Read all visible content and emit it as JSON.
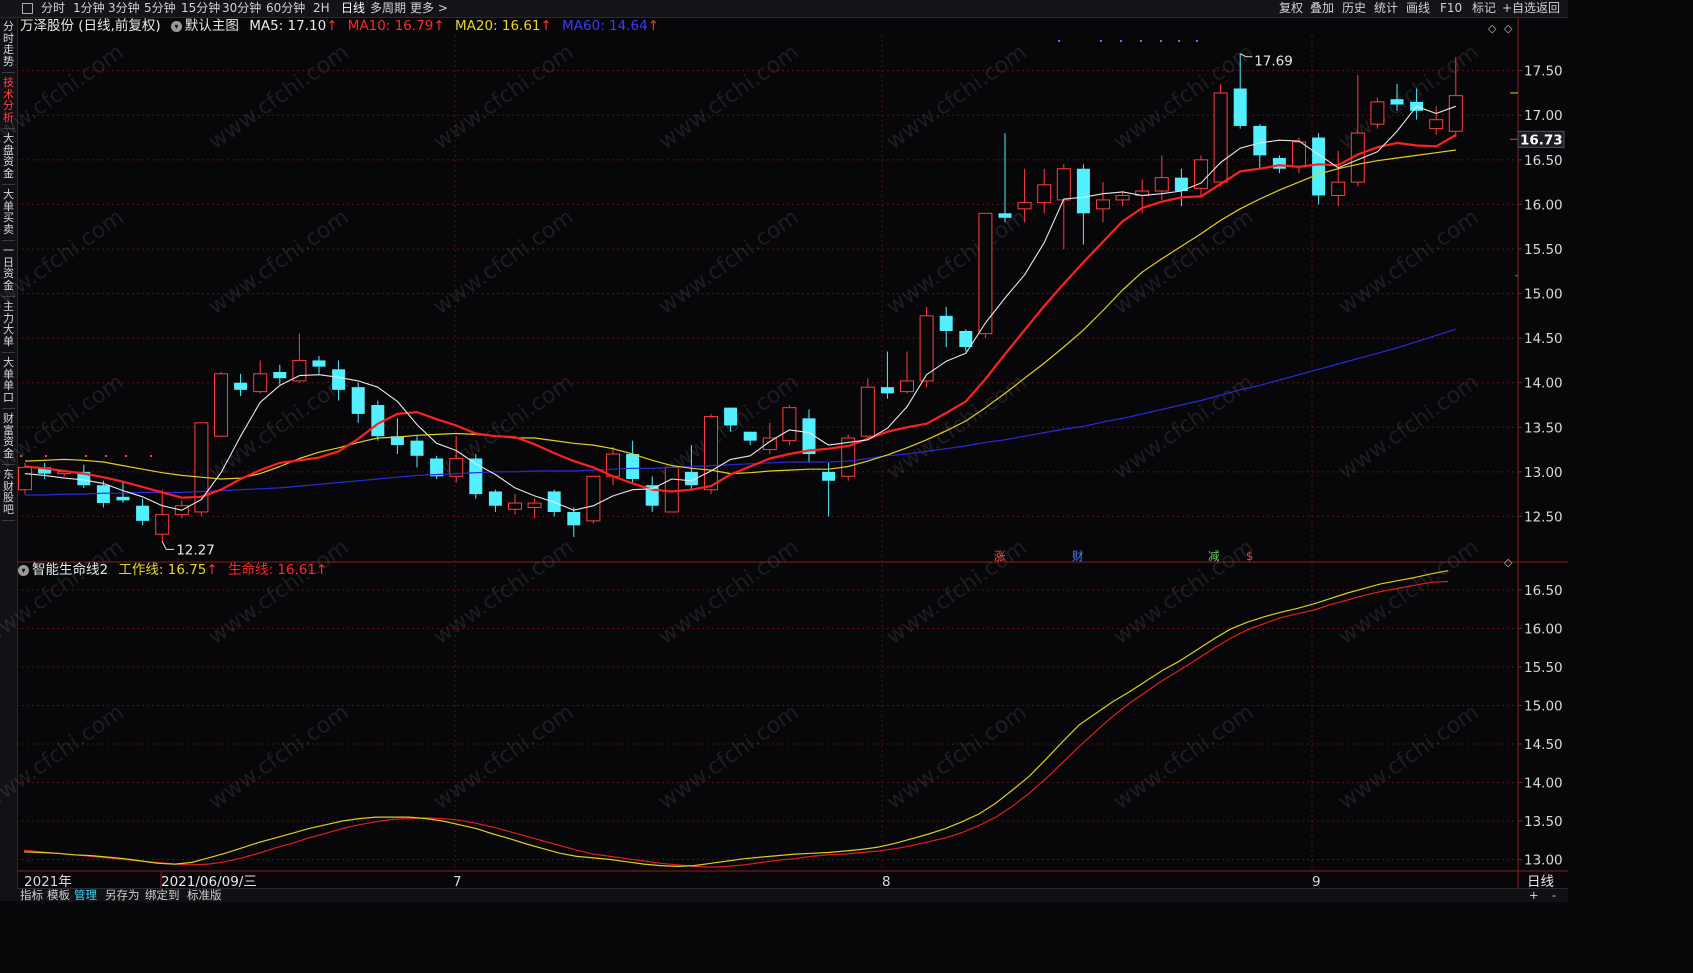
{
  "topbar": {
    "left_items": [
      "分时",
      "1分钟",
      "3分钟",
      "5分钟",
      "15分钟",
      "30分钟",
      "60分钟",
      "2H",
      "日线",
      "多周期",
      "更多 >"
    ],
    "active_left": "日线",
    "right_items": [
      "复权",
      "叠加",
      "历史",
      "统计",
      "画线",
      "F10",
      "标记",
      "+自选",
      "返回"
    ]
  },
  "sidebar": {
    "items": [
      "分时走势",
      "技术分析",
      "大盘资金",
      "大单买卖",
      "一日资金",
      "主力大单",
      "大单单口",
      "财富资金",
      "东财股吧"
    ],
    "active": "技术分析"
  },
  "main_header": {
    "stock": "万泽股份 (日线,前复权)",
    "template": "默认主图",
    "ma5": "MA5: 17.10",
    "ma10": "MA10: 16.79",
    "ma20": "MA20: 16.61",
    "ma60": "MA60: 14.64",
    "arrow": "↑"
  },
  "sub_header": {
    "indicator": "智能生命线2",
    "work": "工作线: 16.75",
    "life": "生命线: 16.61",
    "arrow": "↑"
  },
  "annotations": {
    "high": "17.69",
    "low": "12.27",
    "current": "16.73",
    "events": [
      "涨",
      "财",
      "减",
      "$"
    ]
  },
  "x_axis": {
    "labels": [
      "2021年",
      "2021/06/09/三",
      "7",
      "8",
      "9"
    ],
    "period": "日线"
  },
  "bottom_bar": {
    "items": [
      "指标",
      "模板",
      "管理",
      "另存为",
      "绑定到",
      "标准版"
    ],
    "active": "管理",
    "zoom_in": "+",
    "zoom_out": "-"
  },
  "watermark": "www.cfchi.com",
  "colors": {
    "up": "#ff3c3c",
    "down": "#52f0ff",
    "ma5": "#e8e8e8",
    "ma10": "#ff2020",
    "ma20": "#e0d020",
    "ma60": "#2a2ad8",
    "work": "#d8d020",
    "life": "#e01e1e"
  },
  "chart_data": [
    {
      "type": "candlestick",
      "price_ticks": [
        12.5,
        13.0,
        13.5,
        14.0,
        14.5,
        15.0,
        15.5,
        16.0,
        16.5,
        17.0,
        17.5
      ],
      "ylim": [
        12.0,
        17.9
      ],
      "candles": [
        [
          12.8,
          13.05,
          13.1,
          12.75
        ],
        [
          13.05,
          12.98,
          13.1,
          12.92
        ],
        [
          12.98,
          13.0,
          13.02,
          12.95
        ],
        [
          13.0,
          12.85,
          13.08,
          12.82
        ],
        [
          12.85,
          12.65,
          12.9,
          12.6
        ],
        [
          12.72,
          12.68,
          12.9,
          12.65
        ],
        [
          12.62,
          12.45,
          12.7,
          12.4
        ],
        [
          12.3,
          12.52,
          12.8,
          12.22
        ],
        [
          12.52,
          12.62,
          12.68,
          12.48
        ],
        [
          12.55,
          13.55,
          13.55,
          12.5
        ],
        [
          13.4,
          14.1,
          14.12,
          13.4
        ],
        [
          14.0,
          13.92,
          14.1,
          13.85
        ],
        [
          13.9,
          14.1,
          14.25,
          13.88
        ],
        [
          14.12,
          14.05,
          14.2,
          13.98
        ],
        [
          14.02,
          14.25,
          14.55,
          14.0
        ],
        [
          14.25,
          14.18,
          14.3,
          14.1
        ],
        [
          14.15,
          13.92,
          14.25,
          13.8
        ],
        [
          13.95,
          13.65,
          14.0,
          13.55
        ],
        [
          13.75,
          13.4,
          13.8,
          13.35
        ],
        [
          13.4,
          13.3,
          13.6,
          13.2
        ],
        [
          13.35,
          13.18,
          13.4,
          13.05
        ],
        [
          13.15,
          12.95,
          13.18,
          12.92
        ],
        [
          12.95,
          13.15,
          13.4,
          12.88
        ],
        [
          13.15,
          12.75,
          13.2,
          12.7
        ],
        [
          12.78,
          12.62,
          12.8,
          12.55
        ],
        [
          12.58,
          12.65,
          12.75,
          12.52
        ],
        [
          12.6,
          12.65,
          12.7,
          12.48
        ],
        [
          12.78,
          12.55,
          12.8,
          12.5
        ],
        [
          12.55,
          12.4,
          12.6,
          12.27
        ],
        [
          12.45,
          12.95,
          12.95,
          12.42
        ],
        [
          12.95,
          13.2,
          13.28,
          12.85
        ],
        [
          13.2,
          12.92,
          13.35,
          12.88
        ],
        [
          12.85,
          12.62,
          12.95,
          12.55
        ],
        [
          12.55,
          13.05,
          13.05,
          12.55
        ],
        [
          13.0,
          12.85,
          13.3,
          12.8
        ],
        [
          12.8,
          13.62,
          13.65,
          12.75
        ],
        [
          13.72,
          13.52,
          13.72,
          13.45
        ],
        [
          13.45,
          13.35,
          13.45,
          13.3
        ],
        [
          13.25,
          13.38,
          13.55,
          13.2
        ],
        [
          13.35,
          13.72,
          13.75,
          13.3
        ],
        [
          13.6,
          13.2,
          13.7,
          13.1
        ],
        [
          13.0,
          12.9,
          13.1,
          12.5
        ],
        [
          12.95,
          13.38,
          13.42,
          12.9
        ],
        [
          13.4,
          13.95,
          14.05,
          13.35
        ],
        [
          13.95,
          13.88,
          14.35,
          13.82
        ],
        [
          13.9,
          14.02,
          14.35,
          13.88
        ],
        [
          14.02,
          14.75,
          14.85,
          13.95
        ],
        [
          14.75,
          14.58,
          14.85,
          14.4
        ],
        [
          14.58,
          14.4,
          14.6,
          14.35
        ],
        [
          14.55,
          15.9,
          15.9,
          14.5
        ],
        [
          15.9,
          15.85,
          16.8,
          15.8
        ],
        [
          15.95,
          16.02,
          16.4,
          15.8
        ],
        [
          16.02,
          16.22,
          16.4,
          15.9
        ],
        [
          16.05,
          16.4,
          16.45,
          15.5
        ],
        [
          16.4,
          15.9,
          16.45,
          15.55
        ],
        [
          15.95,
          16.05,
          16.25,
          15.8
        ],
        [
          16.05,
          16.1,
          16.15,
          15.98
        ],
        [
          16.1,
          16.15,
          16.28,
          15.9
        ],
        [
          16.15,
          16.3,
          16.55,
          16.05
        ],
        [
          16.3,
          16.15,
          16.4,
          15.98
        ],
        [
          16.18,
          16.5,
          16.55,
          16.1
        ],
        [
          16.25,
          17.25,
          17.35,
          16.2
        ],
        [
          17.3,
          16.88,
          17.69,
          16.85
        ],
        [
          16.88,
          16.55,
          16.9,
          16.4
        ],
        [
          16.52,
          16.4,
          16.55,
          16.35
        ],
        [
          16.42,
          16.7,
          16.75,
          16.35
        ],
        [
          16.75,
          16.1,
          16.8,
          16.0
        ],
        [
          16.1,
          16.25,
          16.6,
          15.98
        ],
        [
          16.25,
          16.8,
          17.45,
          16.2
        ],
        [
          16.9,
          17.15,
          17.2,
          16.85
        ],
        [
          17.18,
          17.12,
          17.35,
          17.05
        ],
        [
          17.15,
          17.05,
          17.3,
          16.95
        ],
        [
          16.85,
          16.95,
          17.1,
          16.78
        ],
        [
          16.82,
          17.22,
          17.65,
          16.75
        ]
      ],
      "ma5": [
        12.98,
        12.96,
        12.93,
        12.91,
        12.87,
        12.79,
        12.72,
        12.62,
        12.57,
        12.69,
        12.99,
        13.4,
        13.78,
        13.97,
        14.08,
        14.09,
        14.06,
        14.02,
        13.95,
        13.79,
        13.53,
        13.32,
        13.24,
        13.09,
        12.97,
        12.82,
        12.73,
        12.66,
        12.57,
        12.62,
        12.73,
        12.8,
        12.81,
        12.92,
        12.9,
        13.01,
        13.14,
        13.18,
        13.34,
        13.47,
        13.44,
        13.3,
        13.33,
        13.36,
        13.49,
        13.73,
        14.09,
        14.24,
        14.33,
        14.67,
        14.95,
        15.21,
        15.57,
        16.06,
        16.08,
        16.12,
        16.14,
        16.1,
        16.12,
        16.15,
        16.24,
        16.47,
        16.63,
        16.69,
        16.72,
        16.71,
        16.56,
        16.41,
        16.5,
        16.59,
        16.82,
        17.1,
        17.02,
        17.1
      ],
      "ma10": [
        13.06,
        13.04,
        13.01,
        12.98,
        12.94,
        12.89,
        12.83,
        12.77,
        12.71,
        12.72,
        12.8,
        12.92,
        13.02,
        13.1,
        13.13,
        13.16,
        13.23,
        13.37,
        13.54,
        13.65,
        13.67,
        13.59,
        13.52,
        13.43,
        13.4,
        13.39,
        13.31,
        13.21,
        13.12,
        13.05,
        12.95,
        12.87,
        12.8,
        12.78,
        12.8,
        12.84,
        12.97,
        13.06,
        13.15,
        13.2,
        13.24,
        13.26,
        13.29,
        13.37,
        13.45,
        13.5,
        13.54,
        13.66,
        13.79,
        14.04,
        14.32,
        14.59,
        14.86,
        15.11,
        15.35,
        15.58,
        15.81,
        15.96,
        16.03,
        16.08,
        16.09,
        16.23,
        16.37,
        16.4,
        16.44,
        16.42,
        16.45,
        16.44,
        16.56,
        16.64,
        16.69,
        16.66,
        16.65,
        16.78
      ],
      "ma20": [
        13.12,
        13.13,
        13.14,
        13.13,
        13.11,
        13.07,
        13.03,
        12.99,
        12.96,
        12.94,
        12.92,
        12.93,
        12.98,
        13.06,
        13.15,
        13.22,
        13.27,
        13.33,
        13.38,
        13.39,
        13.41,
        13.42,
        13.43,
        13.42,
        13.4,
        13.38,
        13.38,
        13.35,
        13.32,
        13.3,
        13.26,
        13.2,
        13.13,
        13.07,
        13.04,
        13.02,
        12.98,
        12.99,
        13.01,
        13.02,
        13.03,
        13.03,
        13.06,
        13.12,
        13.19,
        13.27,
        13.36,
        13.46,
        13.57,
        13.72,
        13.88,
        14.05,
        14.22,
        14.4,
        14.59,
        14.81,
        15.04,
        15.24,
        15.39,
        15.53,
        15.67,
        15.82,
        15.95,
        16.06,
        16.16,
        16.25,
        16.34,
        16.4,
        16.45,
        16.49,
        16.52,
        16.55,
        16.58,
        16.61
      ],
      "ma60": [
        12.74,
        12.74,
        12.75,
        12.75,
        12.76,
        12.76,
        12.77,
        12.77,
        12.77,
        12.78,
        12.79,
        12.8,
        12.81,
        12.82,
        12.84,
        12.86,
        12.88,
        12.9,
        12.92,
        12.94,
        12.96,
        12.97,
        12.98,
        12.99,
        13.0,
        13.0,
        13.01,
        13.01,
        13.01,
        13.02,
        13.03,
        13.04,
        13.04,
        13.05,
        13.06,
        13.07,
        13.08,
        13.09,
        13.1,
        13.11,
        13.11,
        13.11,
        13.12,
        13.15,
        13.18,
        13.2,
        13.23,
        13.26,
        13.29,
        13.33,
        13.36,
        13.4,
        13.44,
        13.48,
        13.51,
        13.56,
        13.6,
        13.65,
        13.7,
        13.75,
        13.8,
        13.86,
        13.92,
        13.97,
        14.03,
        14.09,
        14.15,
        14.21,
        14.27,
        14.33,
        14.39,
        14.46,
        14.53,
        14.6
      ]
    },
    {
      "type": "line",
      "name": "智能生命线2",
      "y_ticks": [
        13.0,
        13.5,
        14.0,
        14.5,
        15.0,
        15.5,
        16.0,
        16.5
      ],
      "ylim": [
        12.85,
        16.85
      ],
      "series": [
        {
          "name": "工作线",
          "values": [
            13.1,
            13.09,
            13.08,
            13.06,
            13.05,
            13.03,
            13.01,
            12.98,
            12.95,
            12.94,
            12.96,
            13.02,
            13.08,
            13.15,
            13.22,
            13.28,
            13.34,
            13.4,
            13.45,
            13.5,
            13.53,
            13.55,
            13.55,
            13.55,
            13.53,
            13.5,
            13.45,
            13.4,
            13.33,
            13.27,
            13.2,
            13.14,
            13.08,
            13.04,
            13.02,
            13.0,
            12.97,
            12.94,
            12.92,
            12.91,
            12.92,
            12.95,
            12.98,
            13.01,
            13.03,
            13.05,
            13.07,
            13.08,
            13.09,
            13.11,
            13.13,
            13.16,
            13.21,
            13.27,
            13.33,
            13.4,
            13.49,
            13.59,
            13.73,
            13.9,
            14.08,
            14.3,
            14.53,
            14.75,
            14.9,
            15.05,
            15.18,
            15.32,
            15.46,
            15.58,
            15.72,
            15.86,
            15.99,
            16.08,
            16.15,
            16.21,
            16.26,
            16.32,
            16.39,
            16.46,
            16.52,
            16.58,
            16.62,
            16.66,
            16.71,
            16.75
          ]
        },
        {
          "name": "生命线",
          "values": [
            13.12,
            13.1,
            13.08,
            13.06,
            13.04,
            13.02,
            13.0,
            12.98,
            12.96,
            12.94,
            12.93,
            12.94,
            12.97,
            13.02,
            13.08,
            13.15,
            13.21,
            13.28,
            13.34,
            13.4,
            13.45,
            13.49,
            13.52,
            13.53,
            13.54,
            13.53,
            13.51,
            13.47,
            13.42,
            13.36,
            13.3,
            13.24,
            13.18,
            13.12,
            13.07,
            13.04,
            13.01,
            12.98,
            12.95,
            12.93,
            12.91,
            12.9,
            12.91,
            12.93,
            12.96,
            12.99,
            13.01,
            13.04,
            13.06,
            13.07,
            13.09,
            13.11,
            13.14,
            13.18,
            13.23,
            13.28,
            13.35,
            13.44,
            13.55,
            13.69,
            13.86,
            14.05,
            14.26,
            14.47,
            14.67,
            14.86,
            15.03,
            15.18,
            15.33,
            15.46,
            15.6,
            15.74,
            15.87,
            15.98,
            16.06,
            16.14,
            16.19,
            16.24,
            16.31,
            16.37,
            16.43,
            16.48,
            16.52,
            16.56,
            16.6,
            16.61
          ]
        }
      ]
    }
  ]
}
